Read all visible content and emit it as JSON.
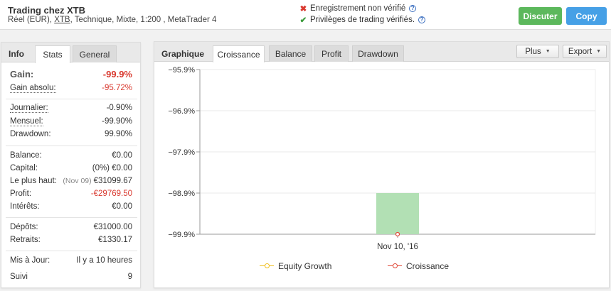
{
  "header": {
    "title": "Trading chez XTB",
    "sub_prefix": "Réel (EUR), ",
    "sub_link": "XTB",
    "sub_suffix": ", Technique, Mixte, 1:200 , MetaTrader 4",
    "verif1": "Enregistrement non vérifié",
    "verif2": "Privilèges de trading vérifiés.",
    "help_glyph": "?",
    "discuss_label": "Discuter",
    "copy_label": "Copy"
  },
  "left_tabs": {
    "info": "Info",
    "stats": "Stats",
    "general": "General"
  },
  "stats": {
    "gain_label": "Gain:",
    "gain_value": "-99.9%",
    "abs_label": "Gain absolu:",
    "abs_value": "-95.72%",
    "daily_label": "Journalier:",
    "daily_value": "-0.90%",
    "monthly_label": "Mensuel:",
    "monthly_value": "-99.90%",
    "drawdown_label": "Drawdown:",
    "drawdown_value": "99.90%",
    "balance_label": "Balance:",
    "balance_value": "€0.00",
    "capital_label": "Capital:",
    "capital_value": "(0%) €0.00",
    "high_label": "Le plus haut:",
    "high_date": "(Nov 09)",
    "high_value": "€31099.67",
    "profit_label": "Profit:",
    "profit_value": "-€29769.50",
    "interest_label": "Intérêts:",
    "interest_value": "€0.00",
    "deposits_label": "Dépôts:",
    "deposits_value": "€31000.00",
    "withdrawals_label": "Retraits:",
    "withdrawals_value": "€1330.17",
    "updated_label": "Mis à Jour:",
    "updated_value": "Il y a 10 heures",
    "followers_label": "Suivi",
    "followers_value": "9"
  },
  "right_tabs": {
    "graph": "Graphique",
    "growth": "Croissance",
    "balance": "Balance",
    "profit": "Profit",
    "drawdown": "Drawdown",
    "more": "Plus",
    "export": "Export"
  },
  "colors": {
    "bar": "#b2e0b4",
    "equity_line": "#f0c020",
    "growth_line": "#e04a3a",
    "red": "#d9392f"
  },
  "chart_data": {
    "type": "bar",
    "categories": [
      "Nov 10, '16"
    ],
    "values": [
      -99.9
    ],
    "bar_top": -98.9,
    "ylim": [
      -99.9,
      -95.9
    ],
    "yticks": [
      -95.9,
      -96.9,
      -97.9,
      -98.9,
      -99.9
    ],
    "ytick_labels": [
      "−95.9%",
      "−96.9%",
      "−97.9%",
      "−98.9%",
      "−99.9%"
    ],
    "series": [
      {
        "name": "Equity Growth",
        "values": []
      },
      {
        "name": "Croissance",
        "values": [
          -99.9
        ]
      }
    ],
    "grid": true,
    "legend": "bottom"
  }
}
